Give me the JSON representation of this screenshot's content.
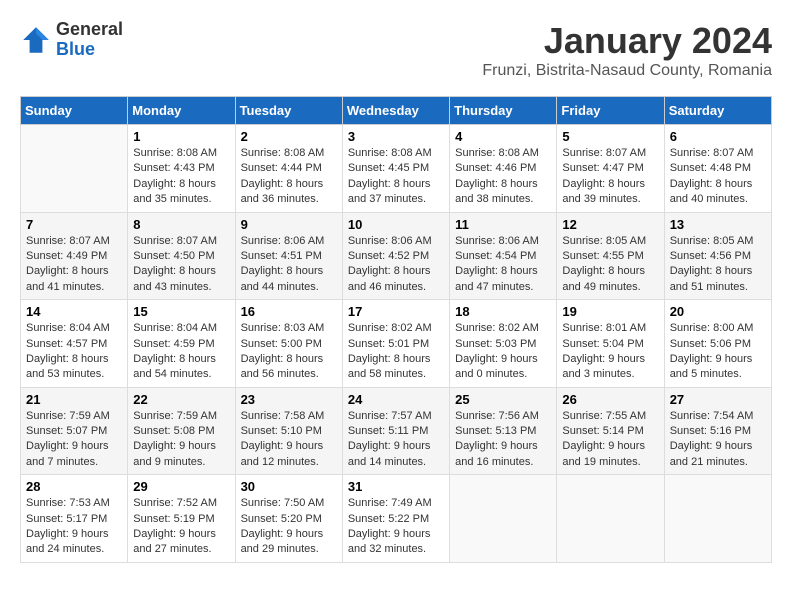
{
  "logo": {
    "general": "General",
    "blue": "Blue"
  },
  "header": {
    "title": "January 2024",
    "subtitle": "Frunzi, Bistrita-Nasaud County, Romania"
  },
  "weekdays": [
    "Sunday",
    "Monday",
    "Tuesday",
    "Wednesday",
    "Thursday",
    "Friday",
    "Saturday"
  ],
  "weeks": [
    [
      {
        "day": "",
        "info": ""
      },
      {
        "day": "1",
        "info": "Sunrise: 8:08 AM\nSunset: 4:43 PM\nDaylight: 8 hours\nand 35 minutes."
      },
      {
        "day": "2",
        "info": "Sunrise: 8:08 AM\nSunset: 4:44 PM\nDaylight: 8 hours\nand 36 minutes."
      },
      {
        "day": "3",
        "info": "Sunrise: 8:08 AM\nSunset: 4:45 PM\nDaylight: 8 hours\nand 37 minutes."
      },
      {
        "day": "4",
        "info": "Sunrise: 8:08 AM\nSunset: 4:46 PM\nDaylight: 8 hours\nand 38 minutes."
      },
      {
        "day": "5",
        "info": "Sunrise: 8:07 AM\nSunset: 4:47 PM\nDaylight: 8 hours\nand 39 minutes."
      },
      {
        "day": "6",
        "info": "Sunrise: 8:07 AM\nSunset: 4:48 PM\nDaylight: 8 hours\nand 40 minutes."
      }
    ],
    [
      {
        "day": "7",
        "info": "Sunrise: 8:07 AM\nSunset: 4:49 PM\nDaylight: 8 hours\nand 41 minutes."
      },
      {
        "day": "8",
        "info": "Sunrise: 8:07 AM\nSunset: 4:50 PM\nDaylight: 8 hours\nand 43 minutes."
      },
      {
        "day": "9",
        "info": "Sunrise: 8:06 AM\nSunset: 4:51 PM\nDaylight: 8 hours\nand 44 minutes."
      },
      {
        "day": "10",
        "info": "Sunrise: 8:06 AM\nSunset: 4:52 PM\nDaylight: 8 hours\nand 46 minutes."
      },
      {
        "day": "11",
        "info": "Sunrise: 8:06 AM\nSunset: 4:54 PM\nDaylight: 8 hours\nand 47 minutes."
      },
      {
        "day": "12",
        "info": "Sunrise: 8:05 AM\nSunset: 4:55 PM\nDaylight: 8 hours\nand 49 minutes."
      },
      {
        "day": "13",
        "info": "Sunrise: 8:05 AM\nSunset: 4:56 PM\nDaylight: 8 hours\nand 51 minutes."
      }
    ],
    [
      {
        "day": "14",
        "info": "Sunrise: 8:04 AM\nSunset: 4:57 PM\nDaylight: 8 hours\nand 53 minutes."
      },
      {
        "day": "15",
        "info": "Sunrise: 8:04 AM\nSunset: 4:59 PM\nDaylight: 8 hours\nand 54 minutes."
      },
      {
        "day": "16",
        "info": "Sunrise: 8:03 AM\nSunset: 5:00 PM\nDaylight: 8 hours\nand 56 minutes."
      },
      {
        "day": "17",
        "info": "Sunrise: 8:02 AM\nSunset: 5:01 PM\nDaylight: 8 hours\nand 58 minutes."
      },
      {
        "day": "18",
        "info": "Sunrise: 8:02 AM\nSunset: 5:03 PM\nDaylight: 9 hours\nand 0 minutes."
      },
      {
        "day": "19",
        "info": "Sunrise: 8:01 AM\nSunset: 5:04 PM\nDaylight: 9 hours\nand 3 minutes."
      },
      {
        "day": "20",
        "info": "Sunrise: 8:00 AM\nSunset: 5:06 PM\nDaylight: 9 hours\nand 5 minutes."
      }
    ],
    [
      {
        "day": "21",
        "info": "Sunrise: 7:59 AM\nSunset: 5:07 PM\nDaylight: 9 hours\nand 7 minutes."
      },
      {
        "day": "22",
        "info": "Sunrise: 7:59 AM\nSunset: 5:08 PM\nDaylight: 9 hours\nand 9 minutes."
      },
      {
        "day": "23",
        "info": "Sunrise: 7:58 AM\nSunset: 5:10 PM\nDaylight: 9 hours\nand 12 minutes."
      },
      {
        "day": "24",
        "info": "Sunrise: 7:57 AM\nSunset: 5:11 PM\nDaylight: 9 hours\nand 14 minutes."
      },
      {
        "day": "25",
        "info": "Sunrise: 7:56 AM\nSunset: 5:13 PM\nDaylight: 9 hours\nand 16 minutes."
      },
      {
        "day": "26",
        "info": "Sunrise: 7:55 AM\nSunset: 5:14 PM\nDaylight: 9 hours\nand 19 minutes."
      },
      {
        "day": "27",
        "info": "Sunrise: 7:54 AM\nSunset: 5:16 PM\nDaylight: 9 hours\nand 21 minutes."
      }
    ],
    [
      {
        "day": "28",
        "info": "Sunrise: 7:53 AM\nSunset: 5:17 PM\nDaylight: 9 hours\nand 24 minutes."
      },
      {
        "day": "29",
        "info": "Sunrise: 7:52 AM\nSunset: 5:19 PM\nDaylight: 9 hours\nand 27 minutes."
      },
      {
        "day": "30",
        "info": "Sunrise: 7:50 AM\nSunset: 5:20 PM\nDaylight: 9 hours\nand 29 minutes."
      },
      {
        "day": "31",
        "info": "Sunrise: 7:49 AM\nSunset: 5:22 PM\nDaylight: 9 hours\nand 32 minutes."
      },
      {
        "day": "",
        "info": ""
      },
      {
        "day": "",
        "info": ""
      },
      {
        "day": "",
        "info": ""
      }
    ]
  ]
}
